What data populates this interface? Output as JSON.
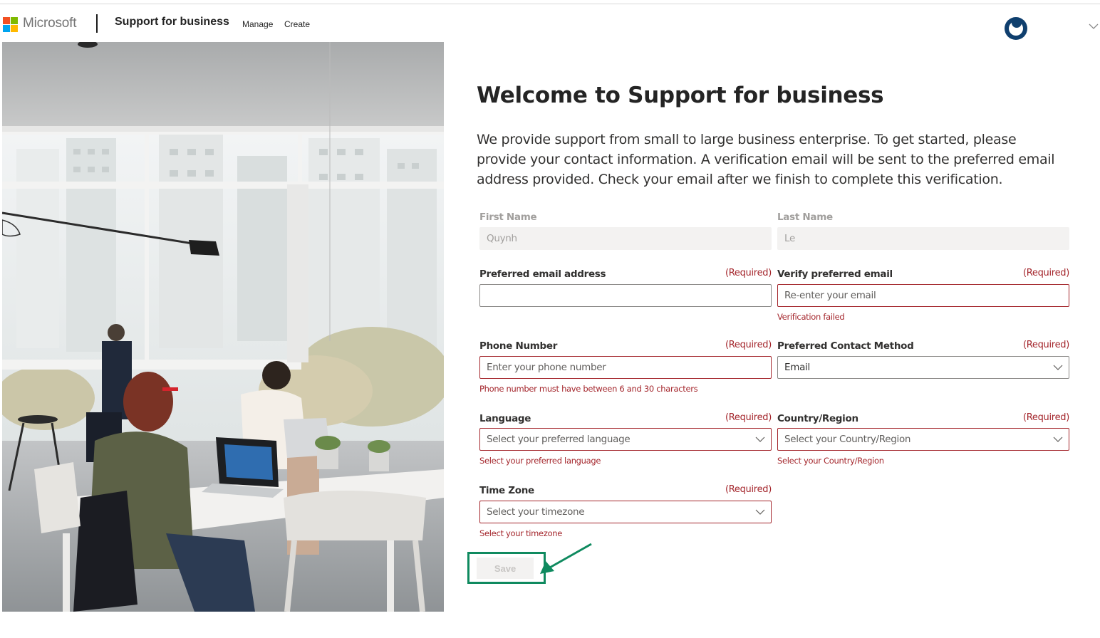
{
  "header": {
    "brand": "Microsoft",
    "app_title": "Support for business",
    "nav": [
      "Manage",
      "Create"
    ],
    "logo_colors": [
      "#f25022",
      "#7fba00",
      "#00a4ef",
      "#ffb900"
    ]
  },
  "main": {
    "title": "Welcome to Support for business",
    "intro": "We provide support from small to large business enterprise. To get started, please provide your contact information. A verification email will be sent to the preferred email address provided. Check your email after we finish to complete this verification."
  },
  "form": {
    "required_text": "(Required)",
    "first_name": {
      "label": "First Name",
      "value": "Quynh"
    },
    "last_name": {
      "label": "Last Name",
      "value": "Le"
    },
    "email": {
      "label": "Preferred email address",
      "value": ""
    },
    "verify_email": {
      "label": "Verify preferred email",
      "placeholder": "Re-enter your email",
      "error": "Verification failed"
    },
    "phone": {
      "label": "Phone Number",
      "placeholder": "Enter your phone number",
      "error": "Phone number must have between 6 and 30 characters"
    },
    "contact_method": {
      "label": "Preferred Contact Method",
      "value": "Email"
    },
    "language": {
      "label": "Language",
      "placeholder": "Select your preferred language",
      "error": "Select your preferred language"
    },
    "country": {
      "label": "Country/Region",
      "placeholder": "Select your Country/Region",
      "error": "Select your Country/Region"
    },
    "timezone": {
      "label": "Time Zone",
      "placeholder": "Select your timezone",
      "error": "Select your timezone"
    },
    "save_label": "Save"
  },
  "colors": {
    "error": "#a4262c",
    "highlight": "#0f8a5f",
    "avatar": "#0f3f6e"
  }
}
